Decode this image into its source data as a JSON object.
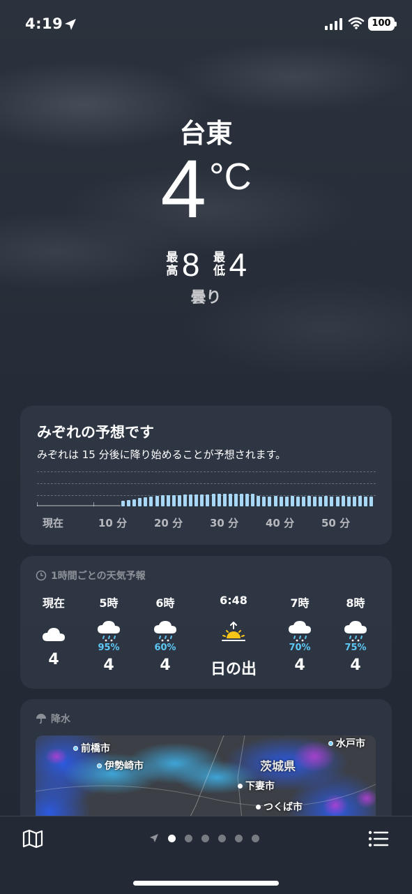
{
  "status_bar": {
    "time": "4:19",
    "battery": "100"
  },
  "location": {
    "city": "台東",
    "temp": "4",
    "unit": "°C",
    "high_label": "最高",
    "high": "8",
    "low_label": "最低",
    "low": "4",
    "condition": "曇り"
  },
  "nowcast": {
    "title": "みぞれの予想です",
    "subtitle": "みぞれは 15 分後に降り始めることが予想されます。",
    "x_labels": [
      "現在",
      "10 分",
      "20 分",
      "30 分",
      "40 分",
      "50 分"
    ]
  },
  "hourly": {
    "header": "1時間ごとの天気予報",
    "items": [
      {
        "time": "現在",
        "icon": "cloud-icon",
        "pct": "",
        "temp": "4"
      },
      {
        "time": "5時",
        "icon": "sleet-icon",
        "pct": "95%",
        "temp": "4"
      },
      {
        "time": "6時",
        "icon": "sleet-icon",
        "pct": "60%",
        "temp": "4"
      },
      {
        "time": "6:48",
        "icon": "sunrise-icon",
        "pct": "",
        "temp": "日の出"
      },
      {
        "time": "7時",
        "icon": "sleet-icon",
        "pct": "70%",
        "temp": "4"
      },
      {
        "time": "8時",
        "icon": "sleet-icon",
        "pct": "75%",
        "temp": "4"
      }
    ]
  },
  "precipitation": {
    "header": "降水",
    "map_labels": {
      "maebashi": "前橋市",
      "isesaki": "伊勢崎市",
      "mito": "水戸市",
      "ibaraki": "茨城県",
      "shimotsuma": "下妻市",
      "tsukuba": "つくば市"
    }
  },
  "colors": {
    "accent_blue": "#5ec8f5",
    "bar_blue": "#a8d8f5",
    "sun": "#f5c518"
  }
}
